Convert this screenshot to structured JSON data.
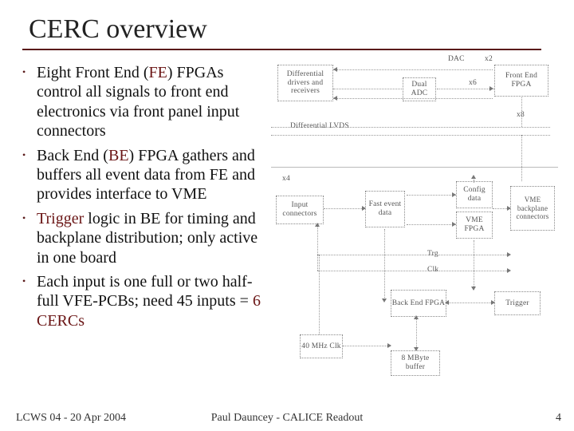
{
  "title": "CERC overview",
  "bullets": [
    {
      "parts": [
        {
          "t": "Eight Front End ("
        },
        {
          "t": "FE",
          "cls": "maroon"
        },
        {
          "t": ") FPGAs control all signals to front end electronics via front panel input connectors"
        }
      ]
    },
    {
      "parts": [
        {
          "t": "Back End ("
        },
        {
          "t": "BE",
          "cls": "maroon"
        },
        {
          "t": ") FPGA gathers and buffers all event data from FE and provides interface to VME"
        }
      ]
    },
    {
      "parts": [
        {
          "t": "Trigger",
          "cls": "maroon"
        },
        {
          "t": " logic in BE for timing and backplane distribution; only active in one board"
        }
      ]
    },
    {
      "parts": [
        {
          "t": "Each input is one full or two half-full VFE-PCBs; need 45 inputs = "
        },
        {
          "t": "6 CERCs",
          "cls": "maroon"
        }
      ]
    }
  ],
  "diagram": {
    "boxes": {
      "diff_drv": "Differential\ndrivers and\nreceivers",
      "dual_adc": "Dual\nADC",
      "fe_fpga": "Front End\nFPGA",
      "input_conn": "Input\nconnectors",
      "fast_event": "Fast\nevent\ndata",
      "config_data": "Config\ndata",
      "vme_fpga": "VME\nFPGA",
      "back_end_fpga": "Back End\nFPGA",
      "clk_40": "40 MHz\nClk",
      "buffer_8mb": "8 MByte\nbuffer",
      "trigger": "Trigger"
    },
    "labels": {
      "dac": "DAC",
      "x2": "x2",
      "x6": "x6",
      "x8": "x8",
      "lvds": "Differential\nLVDS",
      "x4": "x4",
      "trg": "Trg",
      "clk": "Clk",
      "vme_backplane": "VME backplane\nconnectors"
    }
  },
  "footer": {
    "left": "LCWS 04 - 20 Apr 2004",
    "mid": "Paul Dauncey - CALICE Readout",
    "right": "4"
  }
}
